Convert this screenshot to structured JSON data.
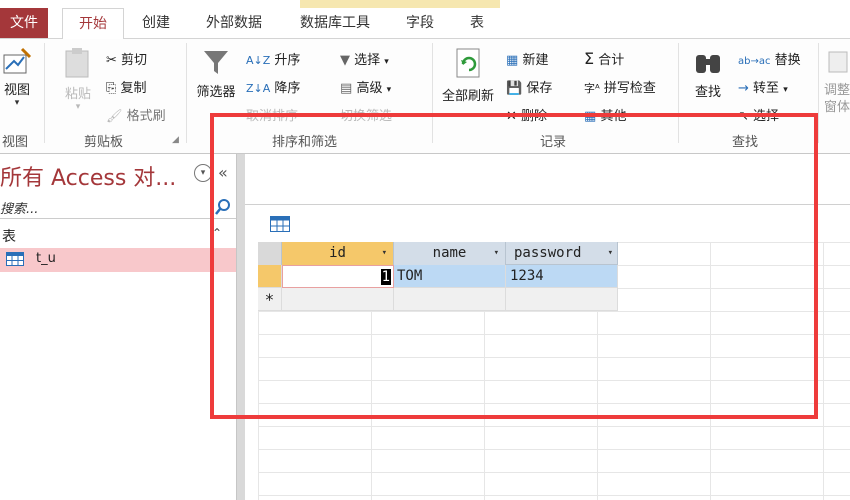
{
  "colors": {
    "accent": "#a4373a",
    "highlight": "#ee3b3b",
    "row_selected": "#bcd9f4",
    "header": "#d3dde8",
    "nav_selected": "#f8c8cb"
  },
  "tabs": {
    "file": "文件",
    "home": "开始",
    "create": "创建",
    "external": "外部数据",
    "dbtools": "数据库工具",
    "fields": "字段",
    "table": "表"
  },
  "ribbon": {
    "view_label": "视图",
    "view_group": "视图",
    "paste": "粘贴",
    "cut": "剪切",
    "copy": "复制",
    "format_painter": "格式刷",
    "clipboard_group": "剪贴板",
    "filter": "筛选器",
    "asc": "升序",
    "desc": "降序",
    "remove_sort": "取消排序",
    "selection": "选择",
    "advanced": "高级",
    "toggle_filter": "切换筛选",
    "sort_group": "排序和筛选",
    "refresh_all": "全部刷新",
    "new": "新建",
    "save": "保存",
    "delete": "删除",
    "totals": "合计",
    "spelling": "拼写检查",
    "more": "其他",
    "records_group": "记录",
    "find": "查找",
    "replace": "替换",
    "goto": "转至",
    "select": "选择",
    "find_group": "查找",
    "size_window": "调整",
    "size_window2": "窗体"
  },
  "nav": {
    "title": "所有 Access 对...",
    "search_placeholder": "搜索...",
    "section": "表",
    "items": [
      {
        "label": "t_u"
      }
    ]
  },
  "datasheet": {
    "columns": [
      "id",
      "name",
      "password"
    ],
    "rows": [
      {
        "id": "1",
        "name": "TOM",
        "password": "1234"
      }
    ],
    "new_row_marker": "*"
  },
  "icons": {
    "collapse": "«",
    "search": "search-icon",
    "chevron_up": "⌃",
    "dropdown": "▾"
  }
}
